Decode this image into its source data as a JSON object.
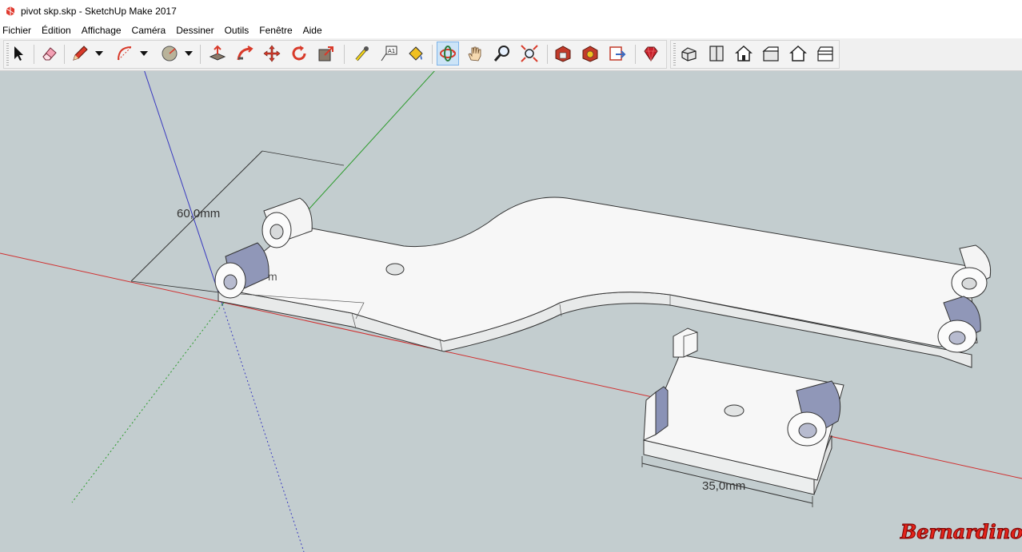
{
  "window": {
    "title": "pivot skp.skp - SketchUp Make 2017",
    "app_icon": "sketchup-icon"
  },
  "menu": {
    "items": [
      "Fichier",
      "Édition",
      "Affichage",
      "Caméra",
      "Dessiner",
      "Outils",
      "Fenêtre",
      "Aide"
    ]
  },
  "toolbar": {
    "tools": [
      "select-arrow-icon",
      "eraser-icon",
      "pencil-icon",
      "arc-icon",
      "shapes-circle-icon",
      "push-pull-icon",
      "follow-me-icon",
      "move-icon",
      "rotate-icon",
      "scale-icon",
      "tape-measure-icon",
      "text-label-icon",
      "paint-bucket-icon",
      "orbit-icon",
      "pan-hand-icon",
      "zoom-icon",
      "zoom-extents-icon",
      "3d-warehouse-icon",
      "extension-warehouse-icon",
      "layout-send-icon",
      "extension-manager-icon",
      "iso-view-icon",
      "top-view-icon",
      "front-view-icon",
      "right-view-icon",
      "back-view-icon",
      "left-view-icon"
    ],
    "active_tool": "orbit-icon"
  },
  "viewport": {
    "background": "#c3cdcf",
    "dimension_60": "60,0mm",
    "dimension_35": "35,0mm",
    "partial_text": "m",
    "watermark": "Bernardino",
    "axis_colors": {
      "red": "#d03030",
      "green": "#2a9a2a",
      "blue": "#3a3ac0"
    }
  }
}
